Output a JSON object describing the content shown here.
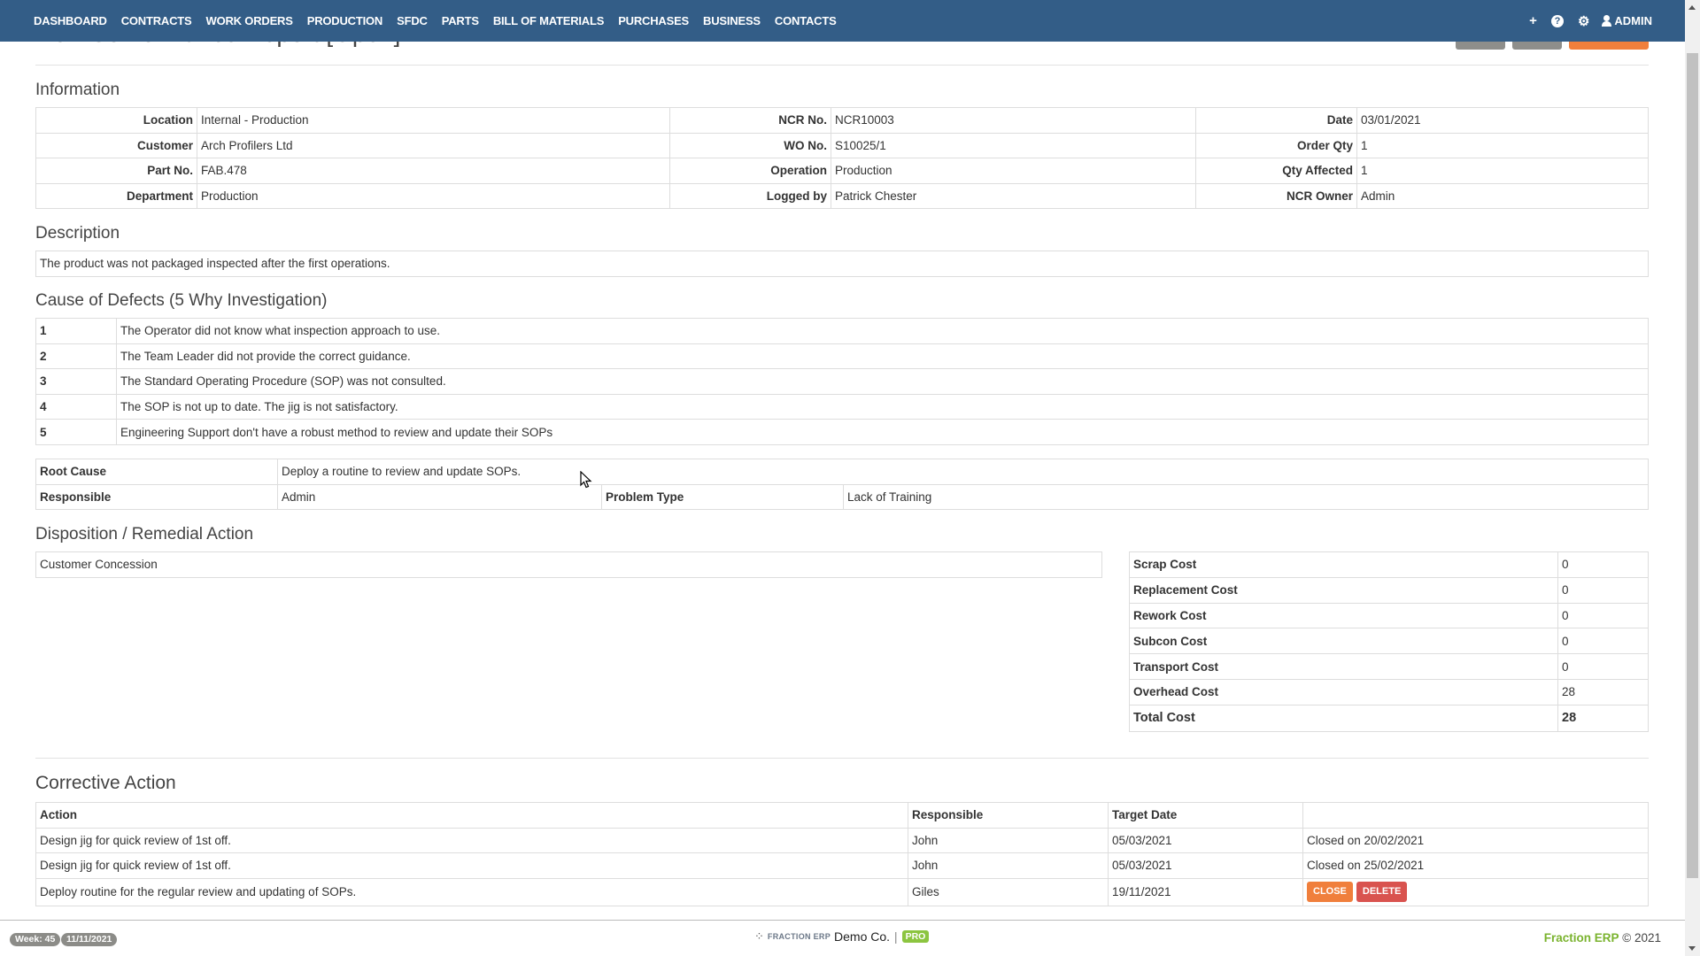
{
  "nav": {
    "items": [
      "DASHBOARD",
      "CONTRACTS",
      "WORK ORDERS",
      "PRODUCTION",
      "SFDC",
      "PARTS",
      "BILL OF MATERIALS",
      "PURCHASES",
      "BUSINESS",
      "CONTACTS"
    ],
    "add_icon": "+",
    "help_icon": "?",
    "settings_icon": "⚙",
    "user_label": "ADMIN"
  },
  "page": {
    "title": "Non-Conformance Report [Open]"
  },
  "information": {
    "heading": "Information",
    "rows": [
      [
        {
          "label": "Location",
          "value": "Internal - Production"
        },
        {
          "label": "NCR No.",
          "value": "NCR10003"
        },
        {
          "label": "Date",
          "value": "03/01/2021"
        }
      ],
      [
        {
          "label": "Customer",
          "value": "Arch Profilers Ltd"
        },
        {
          "label": "WO No.",
          "value": "S10025/1"
        },
        {
          "label": "Order Qty",
          "value": "1"
        }
      ],
      [
        {
          "label": "Part No.",
          "value": "FAB.478"
        },
        {
          "label": "Operation",
          "value": "Production"
        },
        {
          "label": "Qty Affected",
          "value": "1"
        }
      ],
      [
        {
          "label": "Department",
          "value": "Production"
        },
        {
          "label": "Logged by",
          "value": "Patrick Chester"
        },
        {
          "label": "NCR Owner",
          "value": "Admin"
        }
      ]
    ]
  },
  "description": {
    "heading": "Description",
    "text": "The product was not packaged inspected after the first operations."
  },
  "causes": {
    "heading": "Cause of Defects (5 Why Investigation)",
    "rows": [
      {
        "n": "1",
        "text": "The Operator did not know what inspection approach to use."
      },
      {
        "n": "2",
        "text": "The Team Leader did not provide the correct guidance."
      },
      {
        "n": "3",
        "text": "The Standard Operating Procedure (SOP) was not consulted."
      },
      {
        "n": "4",
        "text": "The SOP is not up to date. The jig is not satisfactory."
      },
      {
        "n": "5",
        "text": "Engineering Support don't have a robust method to review and update their SOPs"
      }
    ]
  },
  "root": {
    "root_cause_label": "Root Cause",
    "root_cause_value": "Deploy a routine to review and update SOPs.",
    "responsible_label": "Responsible",
    "responsible_value": "Admin",
    "problem_type_label": "Problem Type",
    "problem_type_value": "Lack of Training"
  },
  "disposition": {
    "heading": "Disposition / Remedial Action",
    "value": "Customer Concession"
  },
  "costs": {
    "rows": [
      {
        "label": "Scrap Cost",
        "value": "0"
      },
      {
        "label": "Replacement Cost",
        "value": "0"
      },
      {
        "label": "Rework Cost",
        "value": "0"
      },
      {
        "label": "Subcon Cost",
        "value": "0"
      },
      {
        "label": "Transport Cost",
        "value": "0"
      },
      {
        "label": "Overhead Cost",
        "value": "28"
      }
    ],
    "total_label": "Total Cost",
    "total_value": "28"
  },
  "corrective": {
    "heading": "Corrective Action",
    "columns": [
      "Action",
      "Responsible",
      "Target Date",
      ""
    ],
    "rows": [
      {
        "action": "Design jig for quick review of 1st off.",
        "responsible": "John",
        "target": "05/03/2021",
        "status": "Closed on 20/02/2021"
      },
      {
        "action": "Design jig for quick review of 1st off.",
        "responsible": "John",
        "target": "05/03/2021",
        "status": "Closed on 25/02/2021"
      },
      {
        "action": "Deploy routine for the regular review and updating of SOPs.",
        "responsible": "Giles",
        "target": "19/11/2021",
        "close_label": "CLOSE",
        "delete_label": "DELETE"
      }
    ]
  },
  "footer": {
    "week": "Week: 45",
    "date": "11/11/2021",
    "brand_logo": "⁘",
    "brand_erp": "FRACTION ERP",
    "company": "Demo Co.",
    "separator": "|",
    "tier": "PRO",
    "copyright_brand": "Fraction ERP",
    "copyright_text": "© 2021"
  },
  "colors": {
    "nav": "#335d87",
    "accent_orange": "#f07f3c",
    "danger": "#d9534f",
    "brand_green": "#7ab32e"
  }
}
